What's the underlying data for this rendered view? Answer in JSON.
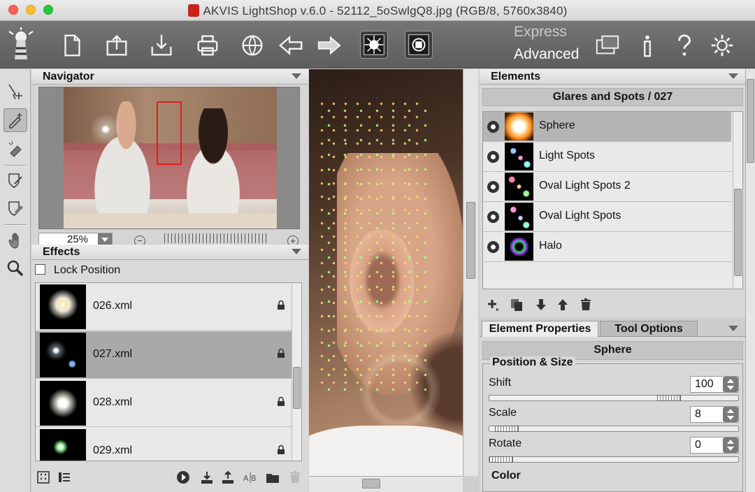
{
  "window": {
    "title": "AKVIS LightShop v.6.0 - 52112_5oSwlgQ8.jpg (RGB/8, 5760x3840)"
  },
  "toolbar": {
    "mode_express": "Express",
    "mode_advanced": "Advanced"
  },
  "navigator": {
    "title": "Navigator",
    "zoom": "25%",
    "zoom_minus": "−",
    "zoom_plus": "+"
  },
  "effects": {
    "title": "Effects",
    "lock_label": "Lock Position",
    "lock_checked": false,
    "items": [
      {
        "name": "026.xml",
        "selected": false
      },
      {
        "name": "027.xml",
        "selected": true
      },
      {
        "name": "028.xml",
        "selected": false
      },
      {
        "name": "029.xml",
        "selected": false
      }
    ]
  },
  "elements": {
    "title": "Elements",
    "group": "Glares and Spots / 027",
    "items": [
      {
        "name": "Sphere",
        "selected": true
      },
      {
        "name": "Light Spots",
        "selected": false
      },
      {
        "name": "Oval Light Spots 2",
        "selected": false
      },
      {
        "name": "Oval Light Spots",
        "selected": false
      },
      {
        "name": "Halo",
        "selected": false
      }
    ]
  },
  "properties": {
    "tab_active": "Element Properties",
    "tab_other": "Tool Options",
    "element": "Sphere",
    "group_title": "Position & Size",
    "shift_label": "Shift",
    "shift_value": "100",
    "scale_label": "Scale",
    "scale_value": "8",
    "rotate_label": "Rotate",
    "rotate_value": "0",
    "color_title": "Color"
  }
}
